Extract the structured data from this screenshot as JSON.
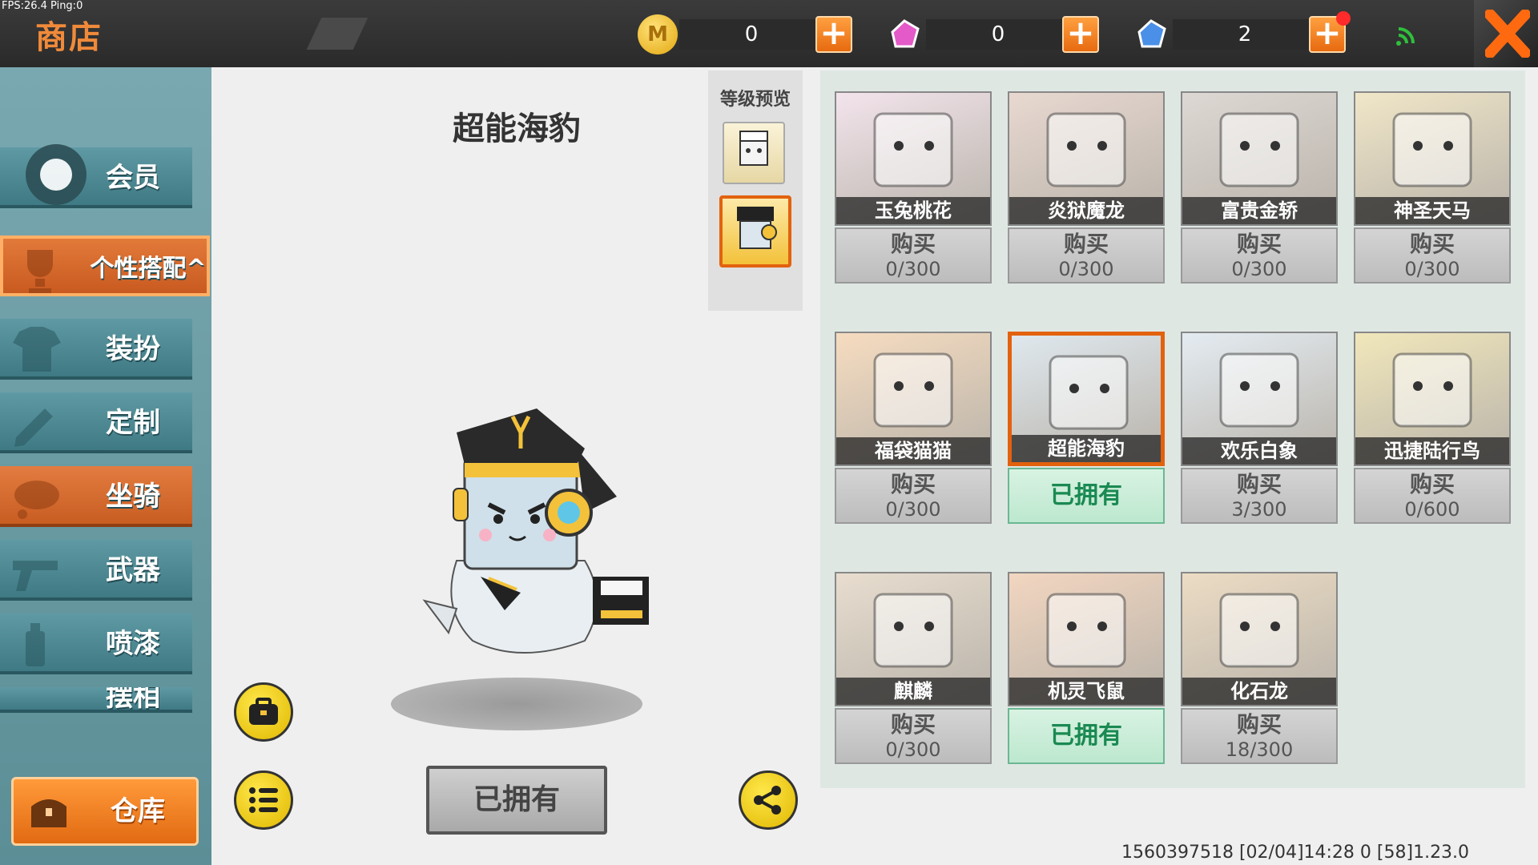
{
  "debug": {
    "fps_text": "FPS:26.4  Ping:0"
  },
  "header": {
    "title": "商店",
    "currencies": [
      {
        "name": "coin",
        "value": "0",
        "icon": "coin-icon",
        "color": "#f2c230"
      },
      {
        "name": "pink-gem",
        "value": "0",
        "icon": "pink-gem-icon",
        "color": "#e45ac8"
      },
      {
        "name": "blue-gem",
        "value": "2",
        "icon": "blue-gem-icon",
        "color": "#4a90e8"
      }
    ],
    "plus_label": "+",
    "close_icon": "close-icon",
    "wifi_icon": "wifi-icon"
  },
  "sidebar": {
    "items": [
      {
        "label": "会员",
        "icon": "vip-icon"
      },
      {
        "label": "个性搭配^",
        "icon": "trophy-icon"
      },
      {
        "label": "装扮",
        "icon": "shirt-icon"
      },
      {
        "label": "定制",
        "icon": "pencil-icon"
      },
      {
        "label": "坐骑",
        "icon": "mount-icon"
      },
      {
        "label": "武器",
        "icon": "gun-icon"
      },
      {
        "label": "喷漆",
        "icon": "spray-icon"
      },
      {
        "label": "摆相",
        "icon": "pose-icon"
      }
    ],
    "warehouse_label": "仓库"
  },
  "preview": {
    "title": "超能海豹",
    "level_preview_label": "等级预览",
    "owned_button": "已拥有"
  },
  "grid": {
    "buy_label": "购买",
    "owned_label": "已拥有",
    "items": [
      {
        "name": "玉兔桃花",
        "price": "0/300",
        "owned": false,
        "bg": "#f3e4ec"
      },
      {
        "name": "炎狱魔龙",
        "price": "0/300",
        "owned": false,
        "bg": "#e8d8d0"
      },
      {
        "name": "富贵金轿",
        "price": "0/300",
        "owned": false,
        "bg": "#ded8d4"
      },
      {
        "name": "神圣天马",
        "price": "0/300",
        "owned": false,
        "bg": "#f0e6c8"
      },
      {
        "name": "福袋猫猫",
        "price": "0/300",
        "owned": false,
        "bg": "#f6dcc0"
      },
      {
        "name": "超能海豹",
        "price": "",
        "owned": true,
        "bg": "#dfe8ee"
      },
      {
        "name": "欢乐白象",
        "price": "3/300",
        "owned": false,
        "bg": "#e4ecf2"
      },
      {
        "name": "迅捷陆行鸟",
        "price": "0/600",
        "owned": false,
        "bg": "#f1e7bb"
      },
      {
        "name": "麒麟",
        "price": "0/300",
        "owned": false,
        "bg": "#e8ddcf"
      },
      {
        "name": "机灵飞鼠",
        "price": "",
        "owned": true,
        "bg": "#f2d6c0"
      },
      {
        "name": "化石龙",
        "price": "18/300",
        "owned": false,
        "bg": "#ecdcc4"
      }
    ]
  },
  "footer": {
    "info": "1560397518   [02/04]14:28 0 [58]1.23.0"
  }
}
